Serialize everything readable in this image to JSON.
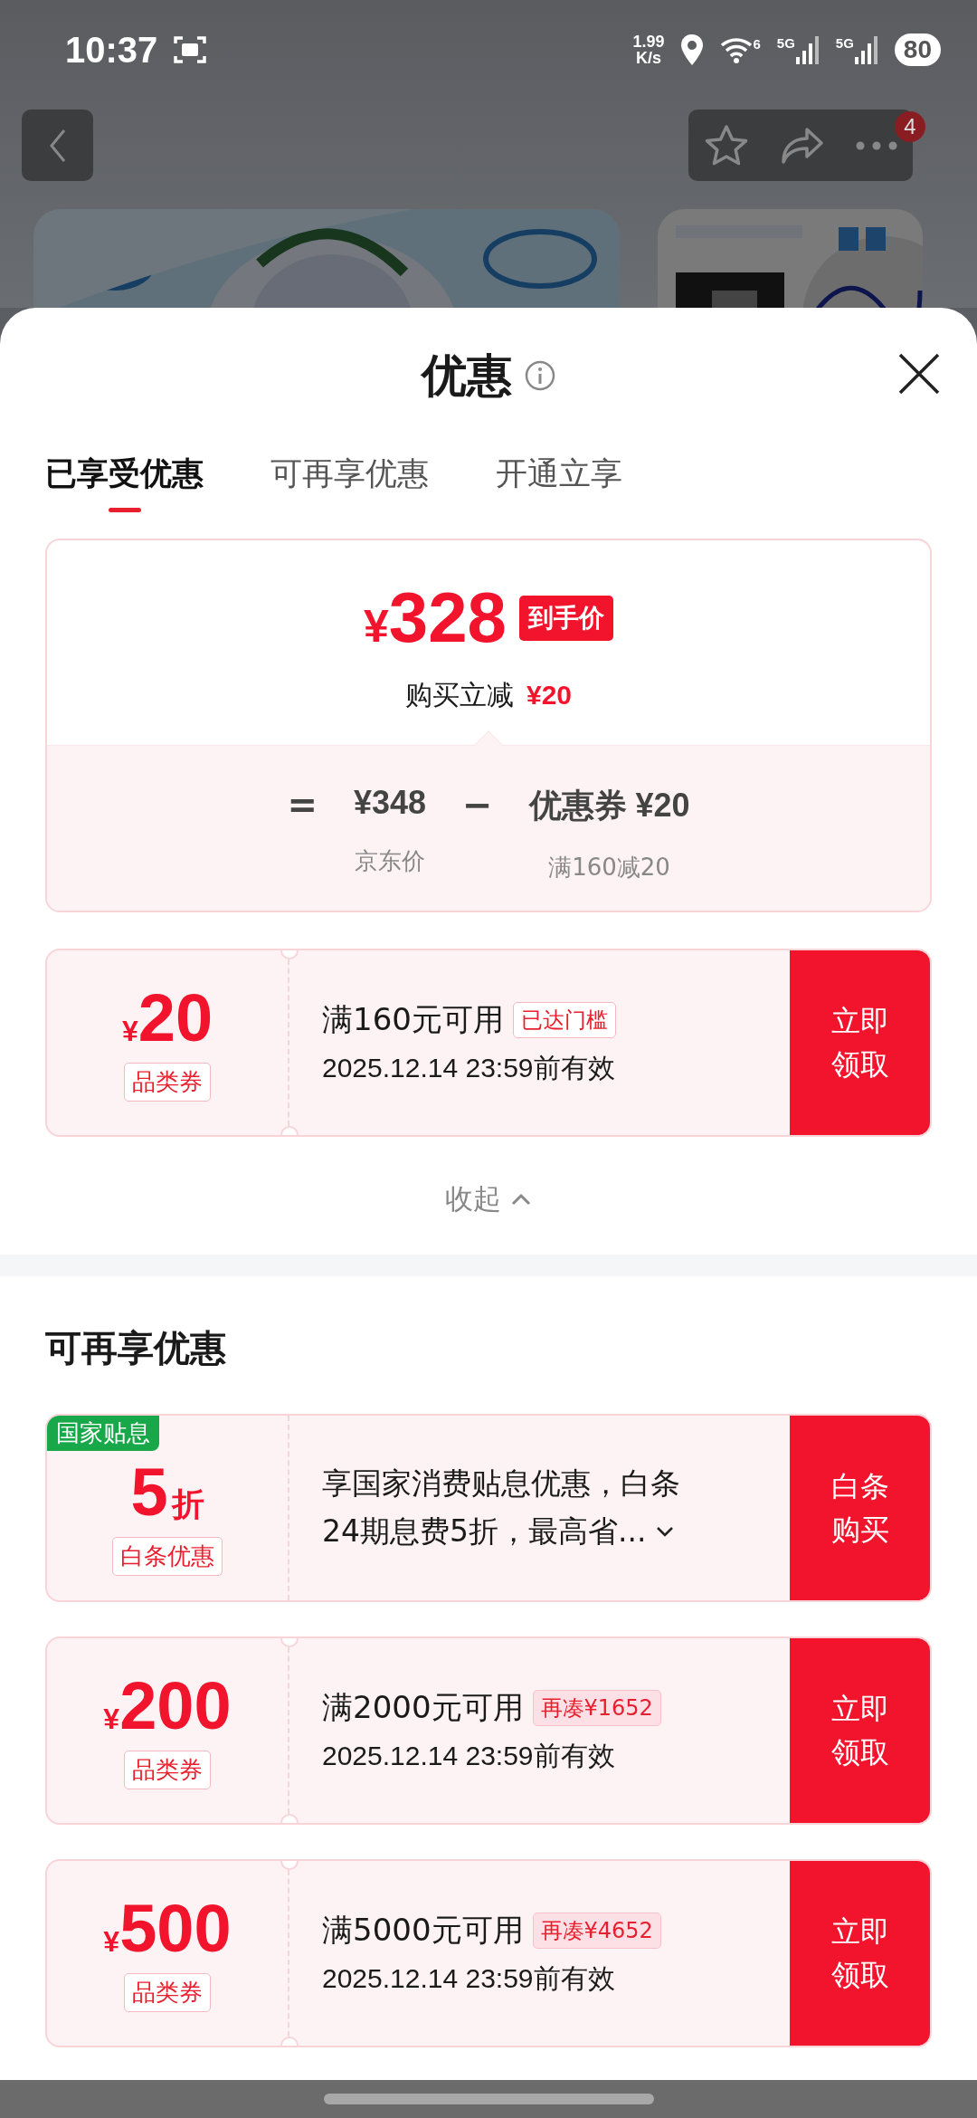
{
  "status_bar": {
    "time": "10:37",
    "net_speed": [
      "1.99",
      "K/s"
    ],
    "wifi_label": "6",
    "signals": [
      "5G",
      "5G"
    ],
    "battery": "80"
  },
  "page_behind": {
    "badge": "4"
  },
  "sheet": {
    "title": "优惠"
  },
  "tabs": [
    {
      "label": "已享受优惠",
      "selected": true
    },
    {
      "label": "可再享优惠",
      "selected": false
    },
    {
      "label": "开通立享",
      "selected": false
    }
  ],
  "price_card": {
    "currency": "¥",
    "price": "328",
    "price_tag": "到手价",
    "saving_label": "购买立减",
    "saving": "¥20",
    "formula": [
      {
        "kind": "operator",
        "value": "="
      },
      {
        "kind": "amount",
        "value": "¥348",
        "caption": "京东价"
      },
      {
        "kind": "operator",
        "value": "−"
      },
      {
        "kind": "amount",
        "value": "优惠券 ¥20",
        "caption": "满160减20"
      }
    ]
  },
  "applied_coupons": [
    {
      "kind": "coupon",
      "currency": "¥",
      "amount": "20",
      "label": "品类券",
      "title": "满160元可用",
      "tag": {
        "kind": "reached",
        "text": "已达门槛"
      },
      "validity": "2025.12.14 23:59前有效",
      "action": "立即领取"
    }
  ],
  "collapse_label": "收起",
  "section_title": "可再享优惠",
  "more_offers": [
    {
      "kind": "subsidy",
      "corner_tag": "国家贴息",
      "amount": "5",
      "unit": "折",
      "label": "白条优惠",
      "lines": [
        "享国家消费贴息优惠，白条",
        "24期息费5折，最高省..."
      ],
      "action": "白条购买"
    },
    {
      "kind": "coupon",
      "currency": "¥",
      "amount": "200",
      "label": "品类券",
      "title": "满2000元可用",
      "tag": {
        "kind": "short",
        "text": "再凑¥1652"
      },
      "validity": "2025.12.14 23:59前有效",
      "action": "立即领取"
    },
    {
      "kind": "coupon",
      "currency": "¥",
      "amount": "500",
      "label": "品类券",
      "title": "满5000元可用",
      "tag": {
        "kind": "short",
        "text": "再凑¥4652"
      },
      "validity": "2025.12.14 23:59前有效",
      "action": "立即领取"
    }
  ]
}
